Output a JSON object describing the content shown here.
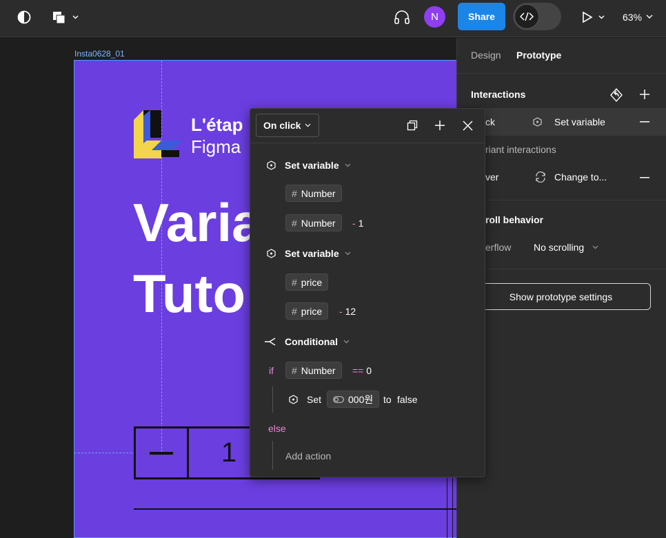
{
  "topbar": {
    "zoom": "63%",
    "avatar_initial": "N",
    "share_label": "Share",
    "dev_mode_icon": "</>"
  },
  "canvas": {
    "frame_label": "Insta0628_01",
    "brand_line1": "L'étap",
    "brand_line2": "Figma",
    "hero_line1": "Varia",
    "hero_line2": "Tuto",
    "stepper_minus": "—",
    "stepper_value": "1"
  },
  "panel": {
    "tab_design": "Design",
    "tab_prototype": "Prototype",
    "interactions_title": "Interactions",
    "interaction1_trigger": "ck",
    "interaction1_action": "Set variable",
    "variant_interactions": "riant interactions",
    "interaction2_trigger": "ver",
    "interaction2_action": "Change to...",
    "scroll_behavior_title": "roll behavior",
    "overflow_label": "erflow",
    "overflow_value": "No scrolling",
    "show_proto_settings": "Show prototype settings"
  },
  "popover": {
    "trigger_label": "On click",
    "action1_title": "Set variable",
    "action1_var": "Number",
    "action1_expr_var": "Number",
    "action1_expr_op": "- 1",
    "action2_title": "Set variable",
    "action2_var": "price",
    "action2_expr_var": "price",
    "action2_expr_op": "- 12",
    "conditional_title": "Conditional",
    "if_label": "if",
    "if_var": "Number",
    "if_op": "==",
    "if_value": "0",
    "set_label": "Set",
    "set_var": "000원",
    "set_to": "to",
    "set_value": "false",
    "else_label": "else",
    "add_action": "Add action"
  },
  "colors": {
    "frame_bg": "#6b3ee0",
    "share_blue": "#1b86e8",
    "avatar_purple": "#8f3ef0",
    "operator_pink": "#e887d8",
    "panel_bg": "#2c2c2c"
  }
}
